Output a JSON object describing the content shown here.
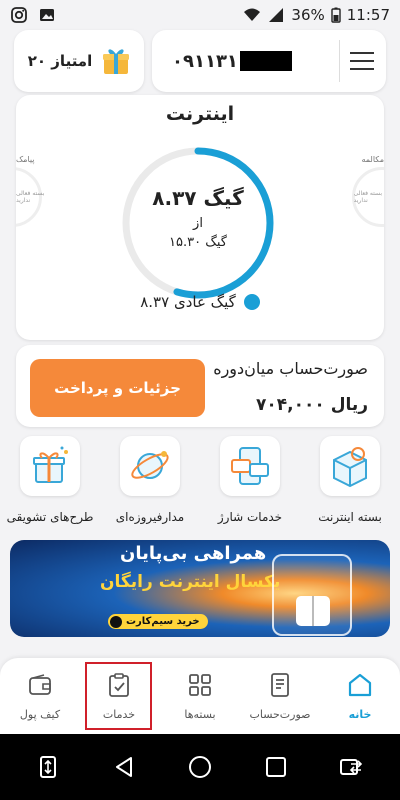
{
  "status_bar": {
    "battery": "36%",
    "time": "11:57"
  },
  "header": {
    "points_label": "۲۰ امتیاز",
    "phone_prefix": "۰۹۱۱۳۱",
    "menu_icon": "hamburger-menu-icon"
  },
  "internet": {
    "title": "اینترنت",
    "remaining": "۸.۳۷ گیگ",
    "from_label": "از",
    "total": "۱۵.۳۰ گیگ",
    "remaining_fraction": 0.547,
    "legend_label": "۸.۳۷ گیگ عادی",
    "left_side_label": "پیامک",
    "left_side_sub": "بسته فعالی\nندارید",
    "right_side_label": "مکالمه",
    "right_side_sub": "بسته فعالی\nندارید",
    "ring_color": "#1a9fd6"
  },
  "bill": {
    "title": "صورت‌حساب میان‌دوره",
    "amount": "۷۰۴,۰۰۰ ریال",
    "pay_button": "جزئیات و پرداخت",
    "button_color": "#f5893a"
  },
  "services": [
    {
      "label": "بسته اینترنت",
      "icon": "internet-package-icon"
    },
    {
      "label": "خدمات شارژ",
      "icon": "charge-services-icon"
    },
    {
      "label": "مدارفیروزه‌ای",
      "icon": "turquoise-orbit-icon"
    },
    {
      "label": "طرح‌های تشویقی",
      "icon": "gift-box-icon"
    }
  ],
  "banner": {
    "line1": "همراهی بی‌پایان",
    "line2": "یکسال اینترنت رایگان",
    "cta": "خرید سیم‌کارت"
  },
  "bottom_nav": [
    {
      "label": "خانه",
      "icon": "home-icon",
      "active": true
    },
    {
      "label": "صورت‌حساب",
      "icon": "bill-icon"
    },
    {
      "label": "بسته‌ها",
      "icon": "packages-grid-icon"
    },
    {
      "label": "خدمات",
      "icon": "services-clipboard-icon"
    },
    {
      "label": "کیف پول",
      "icon": "wallet-icon"
    }
  ],
  "system_nav": [
    "screen-rotate-icon",
    "back-icon",
    "home-circle-icon",
    "recents-icon",
    "screen-switch-icon"
  ]
}
